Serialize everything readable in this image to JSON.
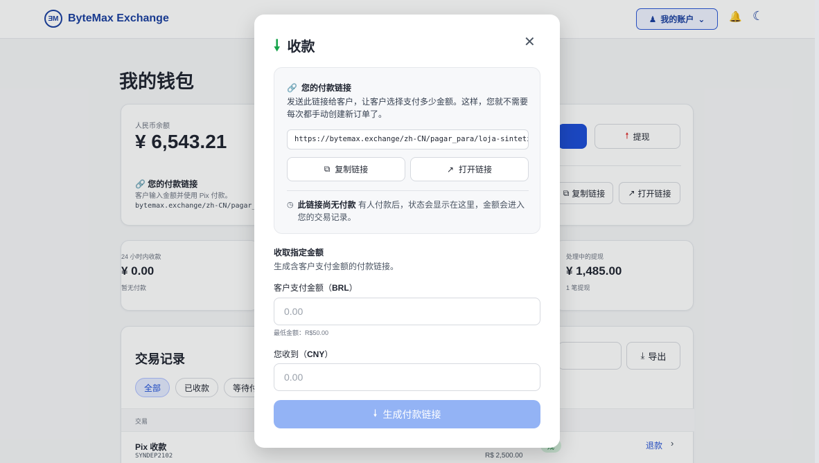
{
  "brand": {
    "logo_text": "ƎM",
    "name": "ByteMax Exchange"
  },
  "header": {
    "account_label": "我的账户",
    "account_icon": "user-icon",
    "bell_icon": "bell-icon",
    "moon_icon": "moon-icon"
  },
  "page": {
    "title": "我的钱包"
  },
  "balance": {
    "label": "人民币余额",
    "amount": "¥ 6,543.21",
    "link_title": "您的付款链接",
    "link_desc": "客户输入金额并使用 Pix 付款。",
    "link_url": "bytemax.exchange/zh-CN/pagar_",
    "withdraw_label": "提现",
    "copy_label": "复制链接",
    "open_label": "打开链接"
  },
  "stats": [
    {
      "label": "24 小时内收款",
      "amount": "¥ 0.00",
      "sub": "暂无付款"
    },
    {
      "label": "处理中的提现",
      "amount": "¥ 1,485.00",
      "sub": "1 笔提现"
    }
  ],
  "transactions": {
    "title": "交易记录",
    "export_label": "导出",
    "filters": [
      "全部",
      "已收款",
      "等待付"
    ],
    "column_header": "交易",
    "rows": [
      {
        "name": "Pix 收款",
        "id": "SYNDEP2102",
        "amount": "R$ 2,500.00",
        "status": "成",
        "action": "退款"
      }
    ]
  },
  "modal": {
    "title": "收款",
    "close_icon": "close-icon",
    "link_box": {
      "title": "您的付款链接",
      "description": "发送此链接给客户，让客户选择支付多少金额。这样，您就不需要每次都手动创建新订单了。",
      "url": "https://bytemax.exchange/zh-CN/pagar_para/loja-sinteti",
      "copy_label": "复制链接",
      "open_label": "打开链接",
      "status_bold": "此链接尚无付款",
      "status_rest": " 有人付款后，状态会显示在这里，金额会进入您的交易记录。"
    },
    "fixed_amount": {
      "title": "收取指定金额",
      "description": "生成含客户支付金额的付款链接。",
      "customer_label": "客户支付金额（",
      "customer_currency": "BRL",
      "customer_label_end": "）",
      "customer_placeholder": "0.00",
      "min_hint": "最低金额：R$50.00",
      "receive_label": "您收到（",
      "receive_currency": "CNY",
      "receive_label_end": "）",
      "receive_placeholder": "0.00",
      "generate_label": "生成付款链接"
    }
  },
  "colors": {
    "accent": "#1d4ed8",
    "success": "#16a34a",
    "disabled_button": "#93b3f5"
  }
}
